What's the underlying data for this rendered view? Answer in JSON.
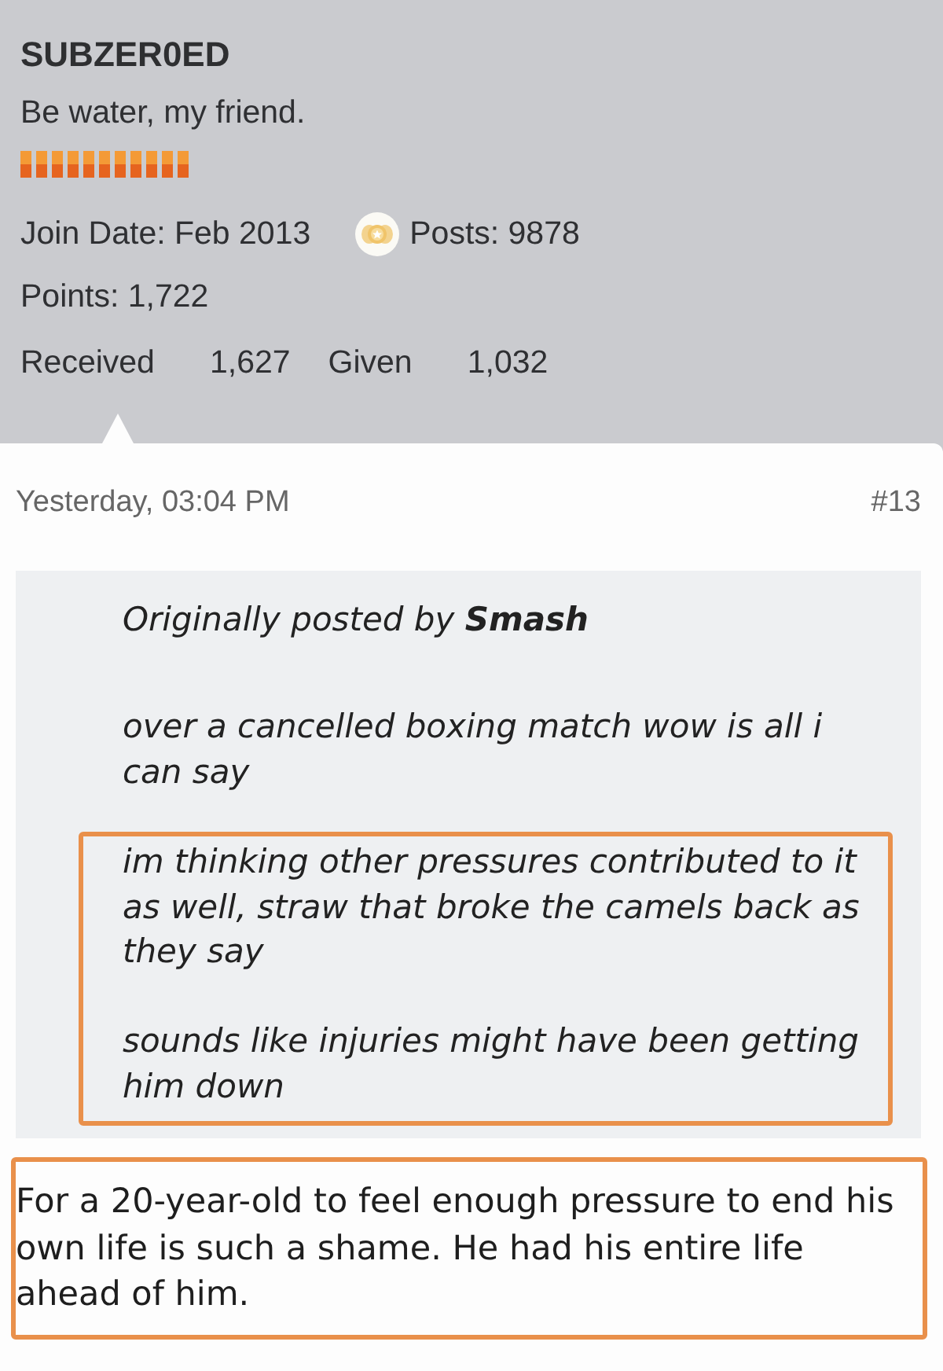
{
  "profile": {
    "username": "SUBZER0ED",
    "user_title": "Be water, my friend.",
    "join_date": "Join Date: Feb 2013",
    "posts": "Posts: 9878",
    "points": "Points: 1,722",
    "likes": [
      {
        "label": "Received",
        "count": "1,627"
      },
      {
        "label": "Given",
        "count": "1,032"
      }
    ]
  },
  "post": {
    "timestamp": "Yesterday, 03:04 PM",
    "number": "#13",
    "quote": {
      "attribution": "Originally posted by **Smash**",
      "blocks": [
        {
          "highlighted": false,
          "paragraphs": [
            "over a cancelled boxing match wow is all i can say"
          ]
        },
        {
          "highlighted": true,
          "paragraphs": [
            "im thinking other pressures contributed to it as well, straw that broke the camels back as they say",
            "sounds like injuries might have been getting him down"
          ]
        }
      ]
    },
    "body": {
      "highlighted": true,
      "text": "For a 20-year-old to feel enough pressure to end his own life is such a shame. He had his entire life ahead of him."
    }
  }
}
